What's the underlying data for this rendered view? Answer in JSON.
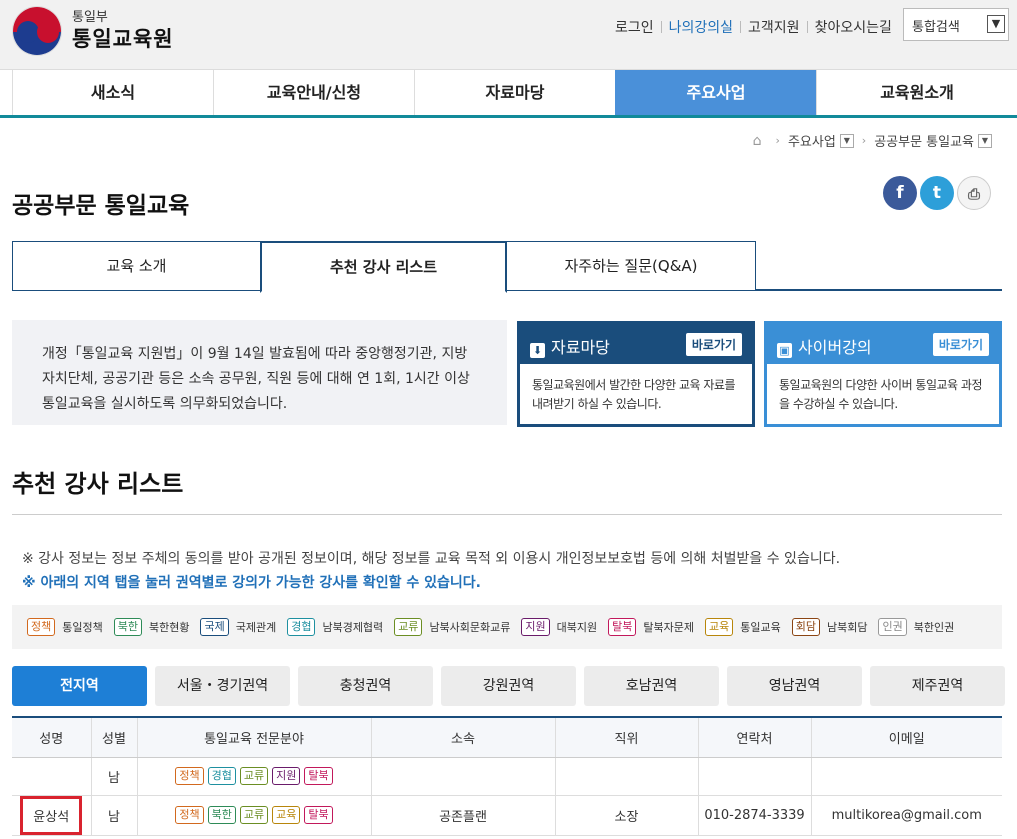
{
  "header": {
    "ministry": "통일부",
    "org": "통일교육원",
    "util": [
      "로그인",
      "나의강의실",
      "고객지원",
      "찾아오시는길"
    ],
    "search_select": "통합검색"
  },
  "gnb": [
    "새소식",
    "교육안내/신청",
    "자료마당",
    "주요사업",
    "교육원소개"
  ],
  "breadcrumb": [
    "주요사업",
    "공공부문 통일교육"
  ],
  "page_title": "공공부문 통일교육",
  "sns": {
    "facebook": "f",
    "twitter": "t",
    "print": "⎙"
  },
  "tabs": [
    "교육 소개",
    "추천 강사 리스트",
    "자주하는 질문(Q&A)"
  ],
  "info": "개정「통일교육 지원법」이 9월 14일 발효됨에 따라 중앙행정기관, 지방자치단체, 공공기관 등은 소속 공무원, 직원 등에 대해 연 1회, 1시간 이상 통일교육을 실시하도록 의무화되었습니다.",
  "cards": [
    {
      "title": "자료마당",
      "go": "바로가기",
      "desc": "통일교육원에서 발간한 다양한 교육 자료를 내려받기 하실 수 있습니다."
    },
    {
      "title": "사이버강의",
      "go": "바로가기",
      "desc": "통일교육원의 다양한 사이버 통일교육 과정을 수강하실 수 있습니다."
    }
  ],
  "section_title": "추천 강사 리스트",
  "notes": [
    "※ 강사 정보는 정보 주체의 동의를 받아 공개된 정보이며, 해당 정보를 교육 목적 외 이용시 개인정보보호법 등에 의해 처벌받을 수 있습니다.",
    "※ 아래의 지역 탭을 눌러 권역별로 강의가 가능한 강사를 확인할 수 있습니다."
  ],
  "legend": [
    {
      "badge": "정책",
      "label": "통일정책",
      "cls": "c-policy"
    },
    {
      "badge": "북한",
      "label": "북한현황",
      "cls": "c-north"
    },
    {
      "badge": "국제",
      "label": "국제관계",
      "cls": "c-intl"
    },
    {
      "badge": "경협",
      "label": "남북경제협력",
      "cls": "c-econ"
    },
    {
      "badge": "교류",
      "label": "남북사회문화교류",
      "cls": "c-exchange"
    },
    {
      "badge": "지원",
      "label": "대북지원",
      "cls": "c-support"
    },
    {
      "badge": "탈북",
      "label": "탈북자문제",
      "cls": "c-defector"
    },
    {
      "badge": "교육",
      "label": "통일교육",
      "cls": "c-edu"
    },
    {
      "badge": "회담",
      "label": "남북회담",
      "cls": "c-talks"
    },
    {
      "badge": "인권",
      "label": "북한인권",
      "cls": "c-rights"
    }
  ],
  "regions": [
    "전지역",
    "서울・경기권역",
    "충청권역",
    "강원권역",
    "호남권역",
    "영남권역",
    "제주권역"
  ],
  "table": {
    "headers": [
      "성명",
      "성별",
      "통일교육 전문분야",
      "소속",
      "직위",
      "연락처",
      "이메일"
    ],
    "rows": [
      {
        "name": "",
        "gender": "남",
        "fields": [
          "정책",
          "경협",
          "교류",
          "지원",
          "탈북"
        ],
        "org": "",
        "position": "",
        "phone": "",
        "email": ""
      },
      {
        "name": "윤상석",
        "gender": "남",
        "fields": [
          "정책",
          "북한",
          "교류",
          "교육",
          "탈북"
        ],
        "org": "공존플랜",
        "position": "소장",
        "phone": "010-2874-3339",
        "email": "multikorea@gmail.com"
      }
    ]
  }
}
